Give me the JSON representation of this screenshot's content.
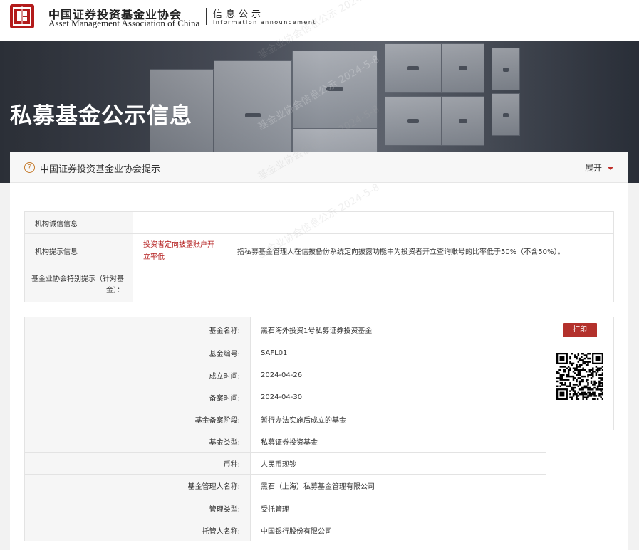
{
  "header": {
    "org_name_cn": "中国证券投资基金业协会",
    "org_name_en": "Asset Management Association of China",
    "section_cn": "信息公示",
    "section_en": "information announcement"
  },
  "banner": {
    "title": "私募基金公示信息"
  },
  "watermark": "基金业协会信息公示 2024-5-8",
  "notice": {
    "text": "中国证券投资基金业协会提示",
    "toggle_label": "展开"
  },
  "credit_table": {
    "rows": [
      {
        "label": "机构诚信信息",
        "tag": "",
        "text": ""
      },
      {
        "label": "机构提示信息",
        "tag": "投资者定向披露账户开立率低",
        "text": "指私募基金管理人在信披备份系统定向披露功能中为投资者开立查询账号的比率低于50%（不含50%）。"
      },
      {
        "label": "基金业协会特别提示（针对基金）：",
        "tag": "",
        "text": ""
      }
    ]
  },
  "fund_table": {
    "print_label": "打印",
    "rows": [
      {
        "key": "基金名称:",
        "value": "黑石海外投资1号私募证券投资基金"
      },
      {
        "key": "基金编号:",
        "value": "SAFL01"
      },
      {
        "key": "成立时间:",
        "value": "2024-04-26"
      },
      {
        "key": "备案时间:",
        "value": "2024-04-30"
      },
      {
        "key": "基金备案阶段:",
        "value": "暂行办法实施后成立的基金"
      },
      {
        "key": "基金类型:",
        "value": "私募证券投资基金"
      },
      {
        "key": "币种:",
        "value": "人民币现钞"
      },
      {
        "key": "基金管理人名称:",
        "value": "黑石（上海）私募基金管理有限公司"
      },
      {
        "key": "管理类型:",
        "value": "受托管理"
      },
      {
        "key": "托管人名称:",
        "value": "中国银行股份有限公司"
      }
    ]
  },
  "colors": {
    "brand_red": "#b31b1b",
    "button_red": "#b3312c",
    "warning_text": "#b31b1b"
  }
}
